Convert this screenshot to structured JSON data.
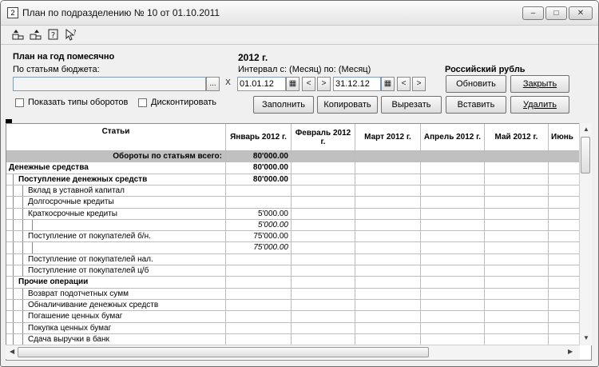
{
  "window": {
    "title": "План по подразделению № 10 от 01.10.2011"
  },
  "toolbar": {
    "icons": [
      "move-up-icon",
      "move-down-icon",
      "help-icon",
      "context-help-icon"
    ]
  },
  "header": {
    "plan_type": "План на год помесячно",
    "year": "2012 г.",
    "budget_items_label": "По статьям бюджета:",
    "budget_items_value": "",
    "interval_label": "Интервал с: (Месяц) по: (Месяц)",
    "date_from": "01.01.12",
    "date_to": "31.12.12",
    "currency": "Российский рубль",
    "show_turnover_types": "Показать типы оборотов",
    "discount": "Дисконтировать"
  },
  "buttons": {
    "refresh": "Обновить",
    "close": "Закрыть",
    "fill": "Заполнить",
    "copy": "Копировать",
    "cut": "Вырезать",
    "paste": "Вставить",
    "delete": "Удалить",
    "browse": "...",
    "clear": "X"
  },
  "grid": {
    "columns": [
      "Статьи",
      "Январь 2012 г.",
      "Февраль 2012 г.",
      "Март 2012 г.",
      "Апрель 2012 г.",
      "Май 2012 г.",
      "Июнь"
    ],
    "rows": [
      {
        "label": "Обороты по статьям всего:",
        "jan": "80'000.00"
      },
      {
        "label": "Денежные средства",
        "jan": "80'000.00"
      },
      {
        "label": "Поступление денежных средств",
        "jan": "80'000.00"
      },
      {
        "label": "Вклад в уставной капитал",
        "jan": ""
      },
      {
        "label": "Долгосрочные кредиты",
        "jan": ""
      },
      {
        "label": "Краткосрочные  кредиты",
        "jan": "5'000.00"
      },
      {
        "label": "",
        "jan": "5'000.00"
      },
      {
        "label": "Поступление от покупателей б/н.",
        "jan": "75'000.00"
      },
      {
        "label": "",
        "jan": "75'000.00"
      },
      {
        "label": "Поступление от покупателей нал.",
        "jan": ""
      },
      {
        "label": "Поступление от покупателей ц/б",
        "jan": ""
      },
      {
        "label": "Прочие операции",
        "jan": ""
      },
      {
        "label": "Возврат подотчетных сумм",
        "jan": ""
      },
      {
        "label": "Обналичивание денежных средств",
        "jan": ""
      },
      {
        "label": "Погашение ценных бумаг",
        "jan": ""
      },
      {
        "label": "Покупка ценных бумаг",
        "jan": ""
      },
      {
        "label": "Сдача выручки в банк",
        "jan": ""
      }
    ]
  },
  "colors": {
    "total_row": "#c0c0c0",
    "border": "#bdbdbd"
  }
}
